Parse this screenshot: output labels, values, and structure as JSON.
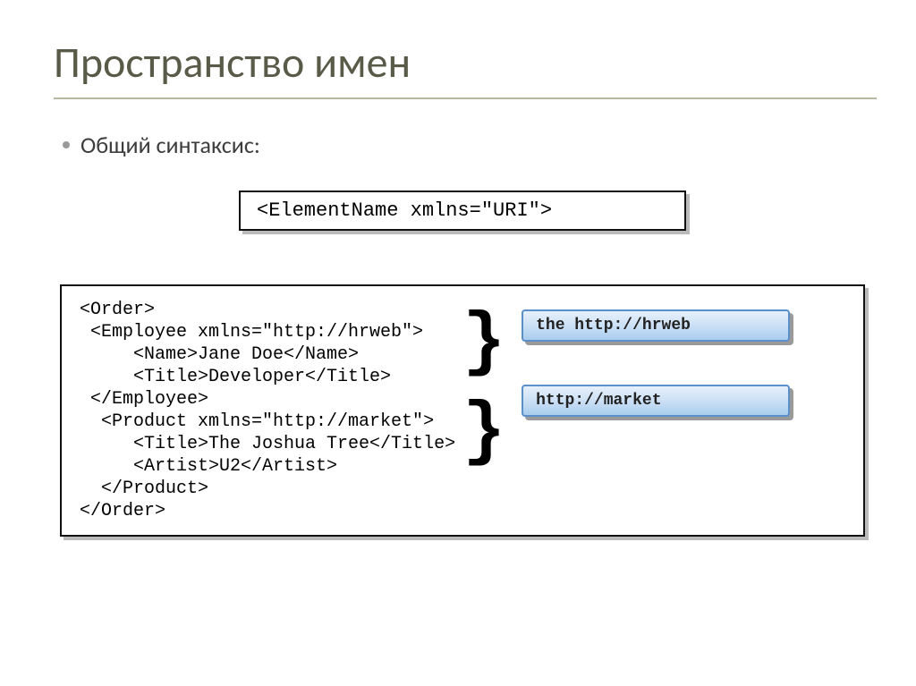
{
  "title": "Пространство имен",
  "bullet": "Общий синтаксис:",
  "syntax": "<ElementName xmlns=\"URI\">",
  "code": {
    "l1": "<Order>",
    "l2": " <Employee xmlns=\"http://hrweb\">",
    "l3": "     <Name>Jane Doe</Name>",
    "l4": "     <Title>Developer</Title>",
    "l5": " </Employee>",
    "l6": "  <Product xmlns=\"http://market\">",
    "l7": "     <Title>The Joshua Tree</Title>",
    "l8": "     <Artist>U2</Artist>",
    "l9": "  </Product>",
    "l10": "</Order>"
  },
  "brace1": "}",
  "brace2": "}",
  "labels": {
    "ns1": "the http://hrweb",
    "ns2": "http://market"
  }
}
